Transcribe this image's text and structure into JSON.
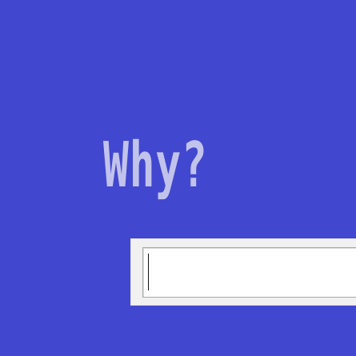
{
  "screen": {
    "prompt_text": "Why?",
    "background_color": "#4147cf",
    "text_color": "#c2c3ec"
  },
  "answer_field": {
    "value": "",
    "placeholder": "",
    "state": "focused-with-caret"
  }
}
